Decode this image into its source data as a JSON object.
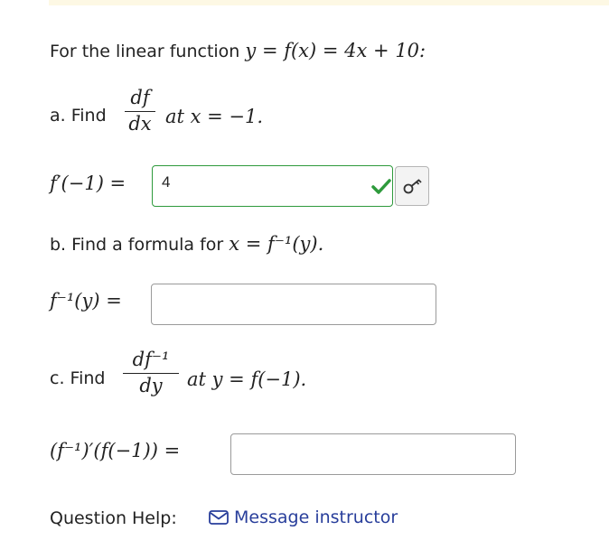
{
  "intro": {
    "prefix": "For the linear function",
    "formula": "y = f(x) = 4x + 10:"
  },
  "part_a": {
    "label": "a. Find",
    "frac_num": "df",
    "frac_den": "dx",
    "suffix": "at x = −1.",
    "answer_label": "f′(−1) =",
    "answer_value": "4"
  },
  "part_b": {
    "prompt_prefix": "b. Find a formula for",
    "prompt_math": "x = f⁻¹(y).",
    "answer_label": "f⁻¹(y) =",
    "answer_value": ""
  },
  "part_c": {
    "label": "c. Find",
    "frac_num": "df⁻¹",
    "frac_den": "dy",
    "suffix": "at y = f(−1).",
    "answer_label": "(f⁻¹)′(f(−1)) =",
    "answer_value": ""
  },
  "help": {
    "label": "Question Help:",
    "link_text": "Message instructor"
  },
  "colors": {
    "correct": "#2e9a3c",
    "link": "#283e9b"
  },
  "icons": {
    "status": "checkmark-icon",
    "keypad": "key-icon",
    "mail": "envelope-icon"
  }
}
